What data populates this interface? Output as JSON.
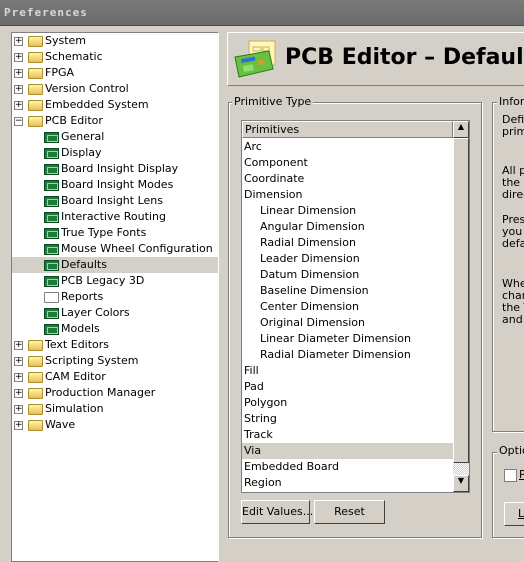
{
  "window": {
    "title": "Preferences"
  },
  "tree": [
    {
      "label": "System",
      "level": 0,
      "expander": "+",
      "icon": "folder-icon"
    },
    {
      "label": "Schematic",
      "level": 0,
      "expander": "+",
      "icon": "folder-icon"
    },
    {
      "label": "FPGA",
      "level": 0,
      "expander": "+",
      "icon": "folder-icon"
    },
    {
      "label": "Version Control",
      "level": 0,
      "expander": "+",
      "icon": "folder-icon"
    },
    {
      "label": "Embedded System",
      "level": 0,
      "expander": "+",
      "icon": "folder-icon"
    },
    {
      "label": "PCB Editor",
      "level": 0,
      "expander": "−",
      "icon": "open-folder-icon"
    },
    {
      "label": "General",
      "level": 1,
      "icon": "pcb-chip-icon"
    },
    {
      "label": "Display",
      "level": 1,
      "icon": "pcb-chip-icon"
    },
    {
      "label": "Board Insight Display",
      "level": 1,
      "icon": "pcb-chip-icon"
    },
    {
      "label": "Board Insight Modes",
      "level": 1,
      "icon": "pcb-chip-icon"
    },
    {
      "label": "Board Insight Lens",
      "level": 1,
      "icon": "pcb-chip-icon"
    },
    {
      "label": "Interactive Routing",
      "level": 1,
      "icon": "pcb-chip-icon"
    },
    {
      "label": "True Type Fonts",
      "level": 1,
      "icon": "pcb-chip-icon"
    },
    {
      "label": "Mouse Wheel Configuration",
      "level": 1,
      "icon": "pcb-chip-icon"
    },
    {
      "label": "Defaults",
      "level": 1,
      "icon": "pcb-chip-icon",
      "selected": true
    },
    {
      "label": "PCB Legacy 3D",
      "level": 1,
      "icon": "pcb-3d-icon"
    },
    {
      "label": "Reports",
      "level": 1,
      "icon": "report-icon"
    },
    {
      "label": "Layer Colors",
      "level": 1,
      "icon": "pcb-chip-icon"
    },
    {
      "label": "Models",
      "level": 1,
      "icon": "pcb-chip-icon"
    },
    {
      "label": "Text Editors",
      "level": 0,
      "expander": "+",
      "icon": "folder-icon"
    },
    {
      "label": "Scripting System",
      "level": 0,
      "expander": "+",
      "icon": "folder-icon"
    },
    {
      "label": "CAM Editor",
      "level": 0,
      "expander": "+",
      "icon": "folder-icon"
    },
    {
      "label": "Production Manager",
      "level": 0,
      "expander": "+",
      "icon": "folder-icon"
    },
    {
      "label": "Simulation",
      "level": 0,
      "expander": "+",
      "icon": "folder-icon"
    },
    {
      "label": "Wave",
      "level": 0,
      "expander": "+",
      "icon": "folder-icon"
    }
  ],
  "header": {
    "title": "PCB Editor – Defaults"
  },
  "primitive_type": {
    "group_label": "Primitive Type",
    "column_header": "Primitives",
    "items": [
      {
        "label": "Arc"
      },
      {
        "label": "Component"
      },
      {
        "label": "Coordinate"
      },
      {
        "label": "Dimension"
      },
      {
        "label": "Linear Dimension",
        "sub": true
      },
      {
        "label": "Angular Dimension",
        "sub": true
      },
      {
        "label": "Radial Dimension",
        "sub": true
      },
      {
        "label": "Leader Dimension",
        "sub": true
      },
      {
        "label": "Datum Dimension",
        "sub": true
      },
      {
        "label": "Baseline Dimension",
        "sub": true
      },
      {
        "label": "Center Dimension",
        "sub": true
      },
      {
        "label": "Original Dimension",
        "sub": true
      },
      {
        "label": "Linear Diameter Dimension",
        "sub": true
      },
      {
        "label": "Radial Diameter Dimension",
        "sub": true
      },
      {
        "label": "Fill"
      },
      {
        "label": "Pad"
      },
      {
        "label": "Polygon"
      },
      {
        "label": "String"
      },
      {
        "label": "Track"
      },
      {
        "label": "Via",
        "selected": true
      },
      {
        "label": "Embedded Board"
      },
      {
        "label": "Region"
      }
    ],
    "edit_values_label": "Edit Values...",
    "reset_label": "Reset"
  },
  "information": {
    "group_label": "Infor",
    "lines": [
      "Defi",
      "prim",
      "",
      "",
      "All p",
      "the ",
      "direc",
      "",
      "Pres",
      "you ",
      "defa",
      "",
      "",
      "Whe",
      "char",
      "the T",
      "and"
    ]
  },
  "options": {
    "group_label": "Optio",
    "checkbox_label": "P",
    "button_label": "L"
  }
}
